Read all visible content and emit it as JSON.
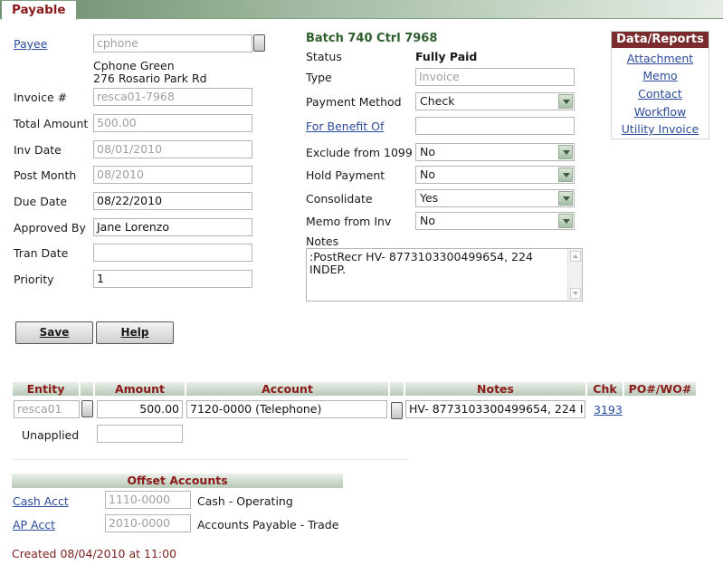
{
  "tab": {
    "label": "Payable"
  },
  "payee": {
    "label": "Payee",
    "value": "cphone",
    "name": "Cphone Green",
    "address": "276 Rosario Park Rd"
  },
  "fields": {
    "invoice_label": "Invoice #",
    "invoice_value": "resca01-7968",
    "total_label": "Total Amount",
    "total_value": "500.00",
    "inv_date_label": "Inv Date",
    "inv_date_value": "08/01/2010",
    "post_month_label": "Post Month",
    "post_month_value": "08/2010",
    "due_date_label": "Due Date",
    "due_date_value": "08/22/2010",
    "approved_label": "Approved By",
    "approved_value": "Jane Lorenzo",
    "tran_date_label": "Tran Date",
    "tran_date_value": "",
    "priority_label": "Priority",
    "priority_value": "1"
  },
  "batch": {
    "text": "Batch 740  Ctrl 7968"
  },
  "right": {
    "status_label": "Status",
    "status_value": "Fully Paid",
    "type_label": "Type",
    "type_placeholder": "Invoice",
    "payment_method_label": "Payment Method",
    "payment_method_value": "Check",
    "for_benefit_label": "For Benefit Of",
    "for_benefit_value": "",
    "exclude_label": "Exclude from 1099",
    "exclude_value": "No",
    "hold_label": "Hold Payment",
    "hold_value": "No",
    "consolidate_label": "Consolidate",
    "consolidate_value": "Yes",
    "memo_inv_label": "Memo from Inv",
    "memo_inv_value": "No",
    "notes_label": "Notes",
    "notes_value": ":PostRecr HV- 8773103300499654, 224 INDEP."
  },
  "reports": {
    "title": "Data/Reports",
    "items": [
      "Attachment",
      "Memo",
      "Contact",
      "Workflow",
      "Utility Invoice"
    ]
  },
  "buttons": {
    "save": "Save",
    "help": "Help"
  },
  "detail": {
    "headers": [
      "Entity",
      "Amount",
      "Account",
      "Notes",
      "Chk",
      "PO#/WO#"
    ],
    "row": {
      "entity": "resca01",
      "amount": "500.00",
      "account": "7120-0000 (Telephone)",
      "notes": "HV- 8773103300499654, 224 I",
      "chk": "3193"
    },
    "unapplied_label": "Unapplied",
    "unapplied_value": ""
  },
  "offset": {
    "title": "Offset Accounts",
    "cash_label": "Cash Acct",
    "cash_value": "1110-0000",
    "cash_desc": "Cash - Operating",
    "ap_label": "AP Acct",
    "ap_value": "2010-0000",
    "ap_desc": "Accounts Payable - Trade"
  },
  "footer": {
    "created": "Created 08/04/2010 at 11:00"
  },
  "colors": {
    "accent": "#8b1a1a",
    "link": "#2b4a9b",
    "green": "#2e5e2e"
  }
}
